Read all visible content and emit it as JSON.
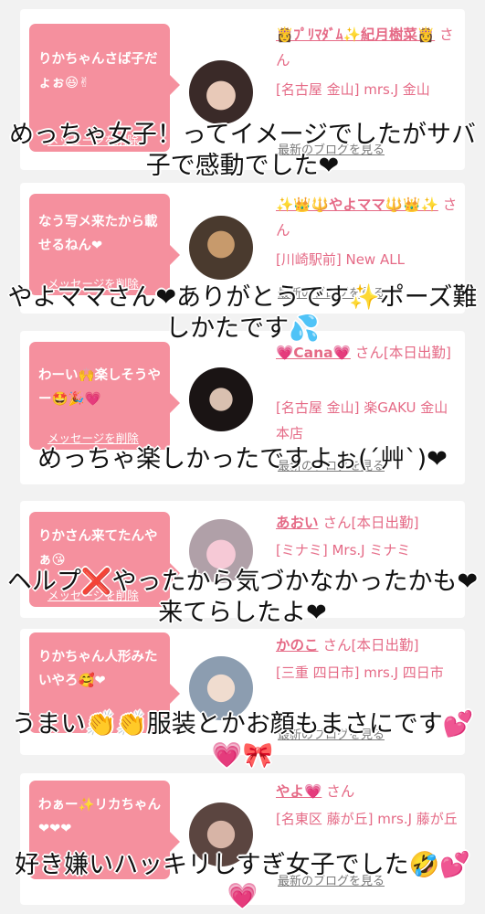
{
  "messages": [
    {
      "bubble": "りかちゃんさば子だょぉ😆✌",
      "delete": "メッセージを削除",
      "name": "👸ﾌﾟﾘﾏﾀﾞﾑ✨紀月樹菜👸",
      "san": "さん",
      "shop": "[名古屋 金山] mrs.J 金山",
      "blog": "最新のブログを見る",
      "overlay": "めっちゃ女子！ってイメージでしたがサバ子で感動でした❤"
    },
    {
      "bubble": "なう写メ来たから載せるねん❤",
      "delete": "メッセージを削除",
      "name": "✨👑🔱やよママ🔱👑✨",
      "san": "さん",
      "shop": "[川崎駅前] New ALL",
      "blog": "最新のブログを見る",
      "overlay": "やよママさん❤ありがとうです✨ポーズ難しかたです💦"
    },
    {
      "bubble": "わーい🙌楽しそうやー🤩🎉💗",
      "delete": "メッセージを削除",
      "name": "💗Cana💗",
      "san": "さん[本日出勤]",
      "shop": "[名古屋 金山] 楽GAKU 金山本店",
      "blog": "最新のブログを見る",
      "overlay": "めっちゃ楽しかったですよぉ(´艸`)❤"
    },
    {
      "bubble": "りかさん来てたんやぁ😘",
      "delete": "メッセージを削除",
      "name": "あおい",
      "san": "さん[本日出勤]",
      "shop": "[ミナミ] Mrs.J ミナミ",
      "blog": "最新のブログを見る",
      "overlay": "ヘルプ❌やったから気づかなかったかも❤来てらしたよ❤"
    },
    {
      "bubble": "りかちゃん人形みたいやろ🥰❤",
      "delete": "メッセージを削除",
      "name": "かのこ",
      "san": "さん[本日出勤]",
      "shop": "[三重 四日市] mrs.J 四日市",
      "blog": "最新のブログを見る",
      "overlay": "うまい👏👏服装とかお顔もまさにです💕💗🎀"
    },
    {
      "bubble": "わぁー✨リカちゃん❤❤❤",
      "delete": "メッセージを削除",
      "name": "やよ💗",
      "san": "さん",
      "shop": "[名東区 藤が丘] mrs.J 藤が丘",
      "blog": "最新のブログを見る",
      "overlay": "好き嫌いハッキリしすぎ女子でした🤣💕💗"
    }
  ],
  "colors": {
    "bubble": "#f5909e",
    "name": "#e56a86",
    "heart": "#d8182f"
  }
}
